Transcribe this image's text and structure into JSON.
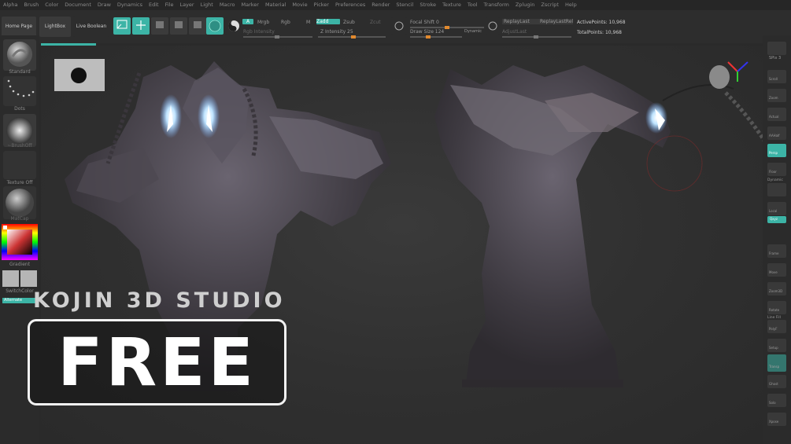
{
  "menu": [
    "Alpha",
    "Brush",
    "Color",
    "Document",
    "Draw",
    "Dynamics",
    "Edit",
    "File",
    "Layer",
    "Light",
    "Macro",
    "Marker",
    "Material",
    "Movie",
    "Picker",
    "Preferences",
    "Render",
    "Stencil",
    "Stroke",
    "Texture",
    "Tool",
    "Transform",
    "Zplugin",
    "Zscript",
    "Help"
  ],
  "toolbar": {
    "home_page": "Home Page",
    "lightbox": "LightBox",
    "live_boolean": "Live Boolean",
    "edit": "Edit",
    "draw": "Draw",
    "move": "Move",
    "scale": "Scale",
    "rotate": "Rotate",
    "a_btn": "A",
    "mrgb": "Mrgb",
    "rgb": "Rgb",
    "m": "M",
    "zadd": "Zadd",
    "zsub": "Zsub",
    "zcut": "Zcut",
    "rgb_intensity": "Rgb Intensity",
    "z_intensity": "Z Intensity 25",
    "focal_shift": "Focal Shift 0",
    "draw_size": "Draw Size 124",
    "dynamic": "Dynamic",
    "replay_last": "ReplayLast",
    "replay_last_rel": "ReplayLastRel",
    "adjust_last": "AdjustLast",
    "active_points": "ActivePoints: 10,968",
    "total_points": "TotalPoints: 10,968"
  },
  "left_panel": {
    "standard": "Standard",
    "dots": "Dots",
    "brush_off": "~BrushOff",
    "texture_off": "Texture Off",
    "material": "MatCap",
    "gradient": "Gradient",
    "switch_color": "SwitchColor",
    "alternate": "Alternate"
  },
  "right_panel": {
    "spix": "SPix 3",
    "scroll": "Scroll",
    "zoom": "Zoom",
    "actual": "Actual",
    "aahalf": "AAHalf",
    "persp": "Persp",
    "floor": "Floor",
    "dynamic": "Dynamic",
    "local": "Local",
    "qxyz": "Qxyz",
    "frame": "Frame",
    "move": "Move",
    "zoom3d": "Zoom3D",
    "rotate": "Rotate",
    "line_fill": "Line Fill",
    "polyf": "PolyF",
    "setup": "Setup",
    "transp": "Transp",
    "ghost": "Ghost",
    "solo": "Solo",
    "xpose": "Xpose"
  },
  "overlay": {
    "studio": "KOJIN 3D STUDIO",
    "free": "FREE"
  },
  "colors": {
    "accent": "#3cb4a6",
    "slider_knob": "#e28a2e",
    "background": "#2a2a2a"
  }
}
